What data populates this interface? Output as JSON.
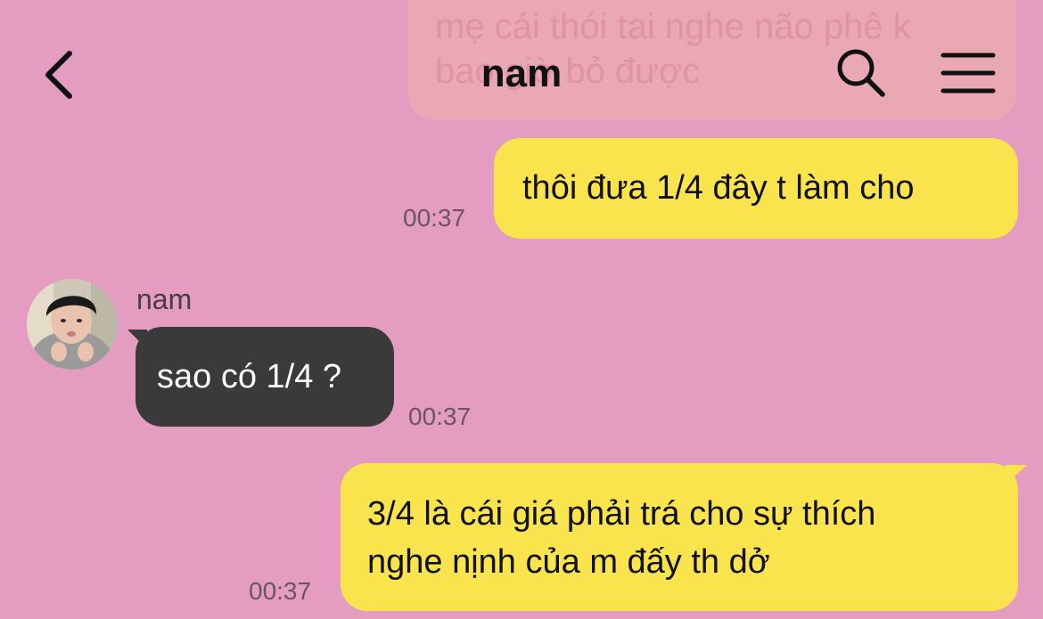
{
  "header": {
    "title": "nam",
    "back_icon": "chevron-left-icon",
    "search_icon": "search-icon",
    "menu_icon": "menu-icon"
  },
  "previous_message": {
    "line1": "mẹ cái thói tai nghe não phê k",
    "line2": "bao giờ bỏ được"
  },
  "messages": [
    {
      "direction": "outgoing",
      "text": "thôi đưa 1/4 đây t làm cho",
      "time": "00:37"
    },
    {
      "direction": "incoming",
      "sender": "nam",
      "text": "sao có 1/4 ?",
      "time": "00:37"
    },
    {
      "direction": "outgoing",
      "lines": [
        "3/4 là cái giá phải trá cho sự thích",
        "nghe nịnh của m đấy th dở"
      ],
      "time": "00:37"
    }
  ],
  "colors": {
    "background": "#E49DC0",
    "outgoing_bubble": "#FAE44E",
    "incoming_bubble": "#3A3A3A",
    "timestamp": "#6A5560"
  }
}
